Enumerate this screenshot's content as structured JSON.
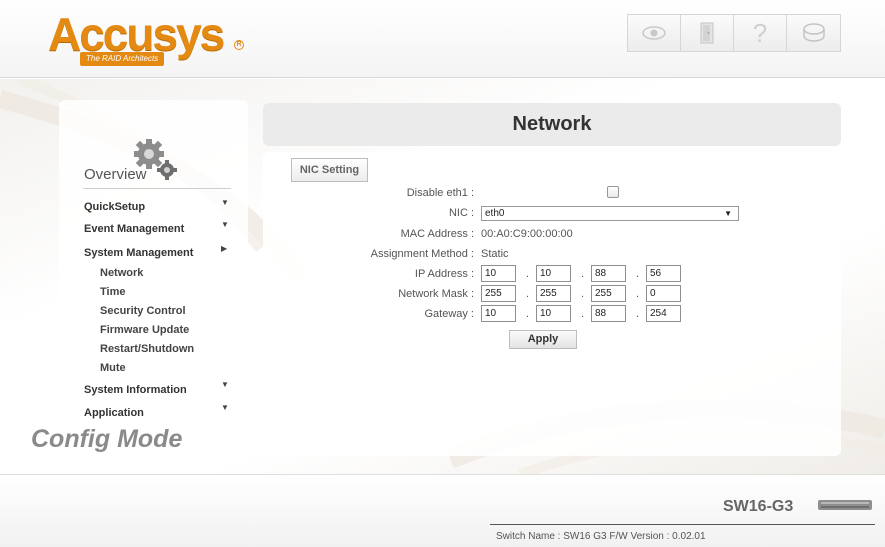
{
  "header": {
    "logo_text": "Accusys",
    "logo_reg": "R",
    "logo_tagline": "The RAID Architects",
    "icons": [
      {
        "name": "eye-icon"
      },
      {
        "name": "door-exit-icon"
      },
      {
        "name": "help-question-icon"
      },
      {
        "name": "disk-icon"
      }
    ]
  },
  "sidebar": {
    "overview": "Overview",
    "items": [
      {
        "label": "QuickSetup",
        "arrow": "▼"
      },
      {
        "label": "Event Management",
        "arrow": "▼"
      },
      {
        "label": "System Management",
        "arrow": "▶"
      },
      {
        "label": "System Information",
        "arrow": "▼"
      },
      {
        "label": "Application",
        "arrow": "▼"
      }
    ],
    "sub_items": [
      "Network",
      "Time",
      "Security Control",
      "Firmware Update",
      "Restart/Shutdown",
      "Mute"
    ],
    "mode": "Config Mode"
  },
  "main": {
    "title": "Network",
    "tab": "NIC Setting",
    "fields": {
      "disable_eth1": {
        "label": "Disable eth1 :",
        "checked": false
      },
      "nic": {
        "label": "NIC :",
        "value": "eth0"
      },
      "mac": {
        "label": "MAC Address :",
        "value": "00:A0:C9:00:00:00"
      },
      "assignment": {
        "label": "Assignment Method :",
        "value": "Static"
      },
      "ip": {
        "label": "IP Address :",
        "octets": [
          "10",
          "10",
          "88",
          "56"
        ]
      },
      "mask": {
        "label": "Network Mask :",
        "octets": [
          "255",
          "255",
          "255",
          "0"
        ]
      },
      "gateway": {
        "label": "Gateway :",
        "octets": [
          "10",
          "10",
          "88",
          "254"
        ]
      }
    },
    "dot": ".",
    "apply": "Apply"
  },
  "footer": {
    "model": "SW16-G3",
    "info": "Switch Name : SW16 G3 F/W Version : 0.02.01"
  },
  "colors": {
    "brand_orange": "#e48a12",
    "panel_gray": "#ebebeb"
  }
}
